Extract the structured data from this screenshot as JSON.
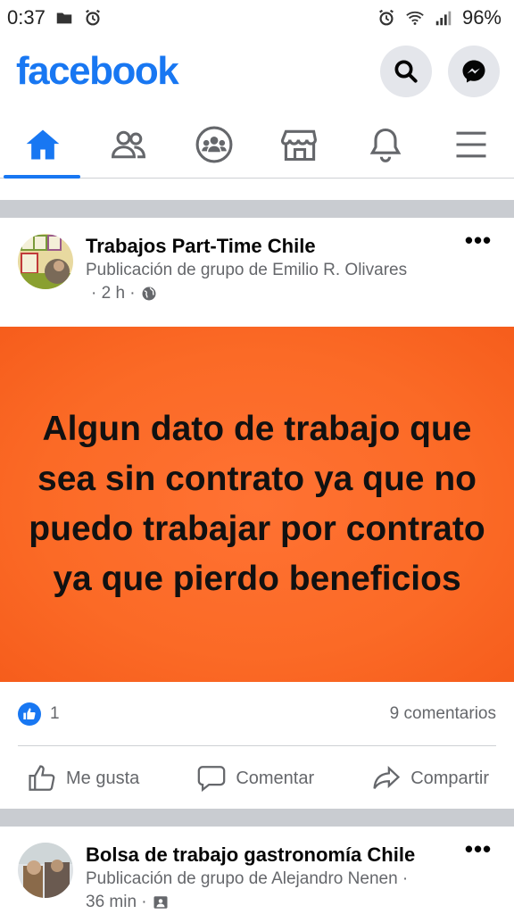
{
  "status_bar": {
    "time": "0:37",
    "battery": "96%",
    "left_icons": [
      "folder-icon",
      "alarm-icon"
    ],
    "right_icons": [
      "alarm-icon",
      "wifi-icon",
      "signal-icon"
    ]
  },
  "header": {
    "logo": "facebook",
    "search_icon": "search-icon",
    "messenger_icon": "messenger-icon"
  },
  "tabs": [
    {
      "name": "home",
      "icon": "home-icon",
      "active": true
    },
    {
      "name": "friends",
      "icon": "friends-icon",
      "active": false
    },
    {
      "name": "groups",
      "icon": "groups-icon",
      "active": false
    },
    {
      "name": "marketplace",
      "icon": "marketplace-icon",
      "active": false
    },
    {
      "name": "notifications",
      "icon": "bell-icon",
      "active": false
    },
    {
      "name": "menu",
      "icon": "menu-icon",
      "active": false
    }
  ],
  "posts": [
    {
      "group": "Trabajos Part-Time Chile",
      "subtitle": "Publicación de grupo de Emilio R. Olivares",
      "time": "· 2 h ·",
      "privacy_icon": "globe-icon",
      "image_text": "Algun dato de trabajo que sea sin contrato ya que no puedo trabajar por contrato ya que pierdo beneficios",
      "likes": "1",
      "comments": "9 comentarios",
      "actions": {
        "like": "Me gusta",
        "comment": "Comentar",
        "share": "Compartir"
      }
    },
    {
      "group": "Bolsa de trabajo gastronomía Chile",
      "subtitle": "Publicación de grupo de Alejandro Nenen ·",
      "time": "36 min ·",
      "privacy_icon": "group-privacy-icon"
    }
  ],
  "colors": {
    "brand": "#1877f2",
    "post_image_bg": "#fb6a26",
    "divider": "#c9ccd1"
  }
}
